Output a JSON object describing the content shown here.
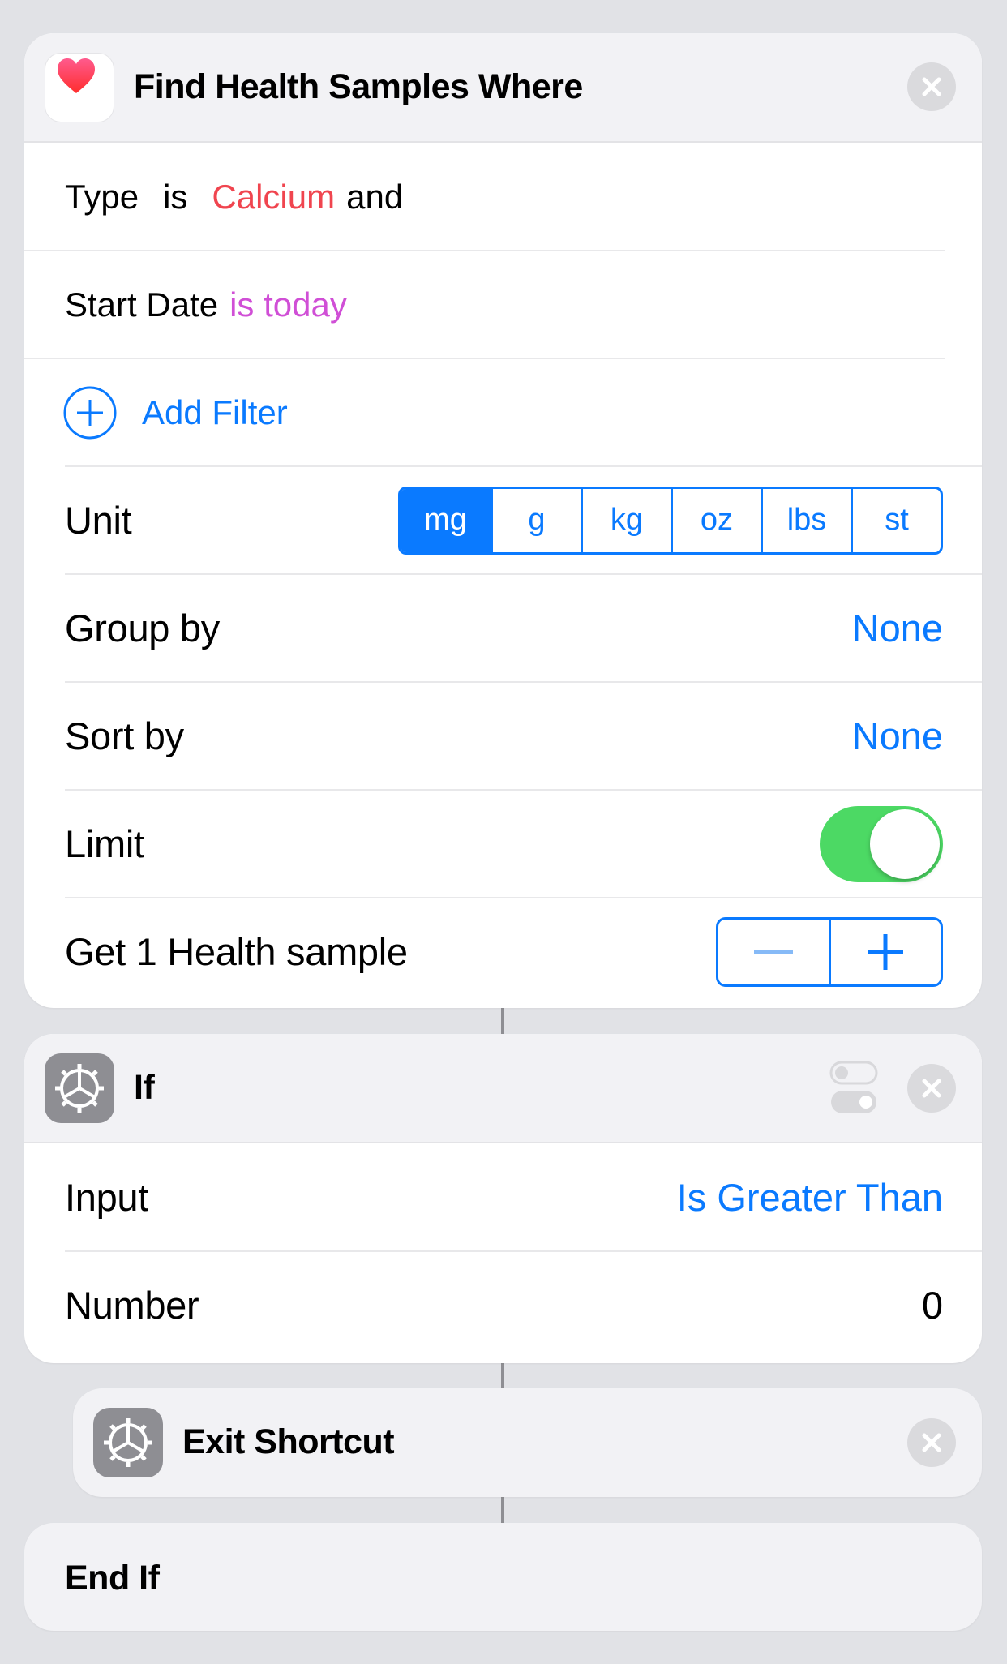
{
  "find_action": {
    "title": "Find Health Samples Where",
    "icon": "heart-icon",
    "filters": [
      {
        "field": "Type",
        "operator": "is",
        "value": "Calcium",
        "conjunction": "and"
      },
      {
        "field": "Start Date",
        "value": "is today"
      }
    ],
    "add_filter_label": "Add Filter",
    "unit_label": "Unit",
    "units": [
      "mg",
      "g",
      "kg",
      "oz",
      "lbs",
      "st"
    ],
    "selected_unit": "mg",
    "group_by_label": "Group by",
    "group_by_value": "None",
    "sort_by_label": "Sort by",
    "sort_by_value": "None",
    "limit_label": "Limit",
    "limit_on": true,
    "get_label": "Get 1 Health sample"
  },
  "if_action": {
    "title": "If",
    "icon": "gear-icon",
    "input_label": "Input",
    "input_value": "Is Greater Than",
    "number_label": "Number",
    "number_value": "0"
  },
  "exit_action": {
    "title": "Exit Shortcut",
    "icon": "gear-icon"
  },
  "end_if": {
    "title": "End If"
  },
  "colors": {
    "accent": "#0a7aff",
    "calcium": "#f0454f",
    "date": "#d04fd6",
    "toggle_on": "#4cd964"
  }
}
